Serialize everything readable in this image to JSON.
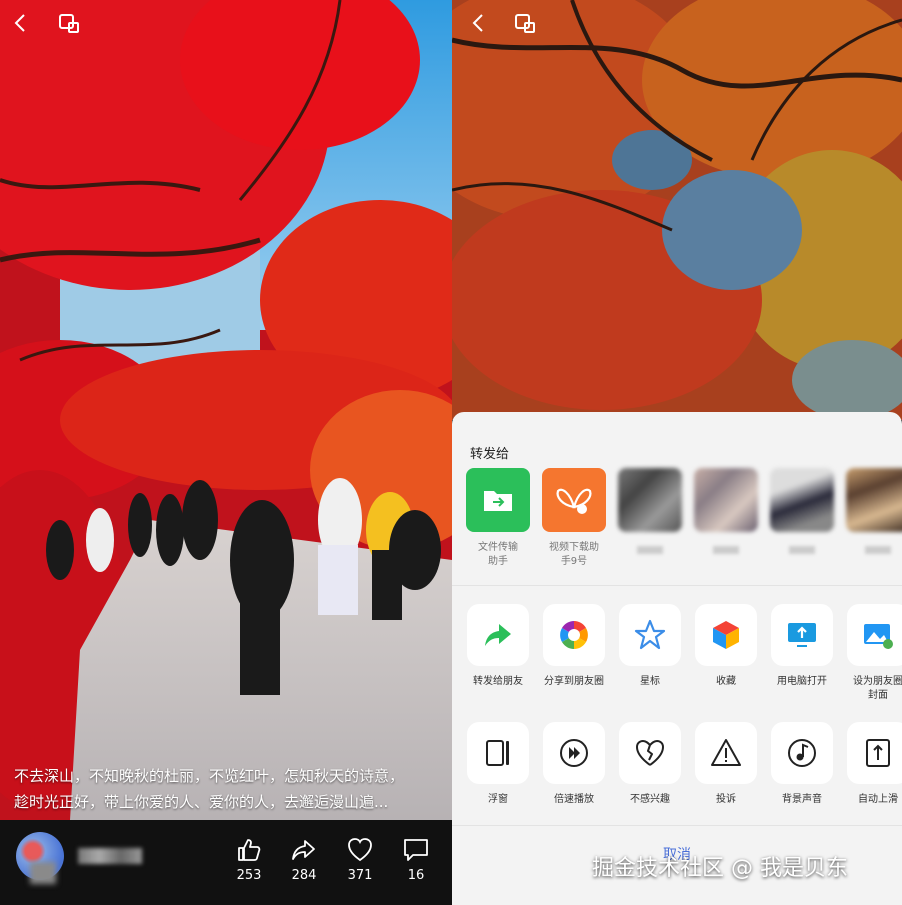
{
  "left": {
    "caption_line1": "不去深山，不知晚秋的杜丽，不览红叶，怎知秋天的诗意，",
    "caption_line2": "趁时光正好，带上你爱的人、爱你的人，去邂逅漫山遍...",
    "actions": [
      {
        "icon": "thumbs-up-icon",
        "count": "253"
      },
      {
        "icon": "share-arrow-icon",
        "count": "284"
      },
      {
        "icon": "heart-icon",
        "count": "371"
      },
      {
        "icon": "comment-icon",
        "count": "16"
      }
    ]
  },
  "sheet": {
    "title": "转发给",
    "contacts": [
      {
        "label": "文件传输\n助手",
        "color": "#2bbf5a"
      },
      {
        "label": "视频下载助\n手9号",
        "color": "#f5762f"
      }
    ],
    "row1": [
      {
        "label": "转发给朋友",
        "icon": "forward-arrow-icon"
      },
      {
        "label": "分享到朋友圈",
        "icon": "moments-aperture-icon"
      },
      {
        "label": "星标",
        "icon": "star-icon"
      },
      {
        "label": "收藏",
        "icon": "favorites-cube-icon"
      },
      {
        "label": "用电脑打开",
        "icon": "computer-icon"
      },
      {
        "label": "设为朋友圈\n封面",
        "icon": "cover-image-icon"
      }
    ],
    "row2": [
      {
        "label": "浮窗",
        "icon": "float-window-icon"
      },
      {
        "label": "倍速播放",
        "icon": "playback-speed-icon"
      },
      {
        "label": "不感兴趣",
        "icon": "broken-heart-icon"
      },
      {
        "label": "投诉",
        "icon": "warning-icon"
      },
      {
        "label": "背景声音",
        "icon": "music-note-icon"
      },
      {
        "label": "自动上滑",
        "icon": "auto-scroll-icon"
      }
    ],
    "cancel": "取消"
  },
  "watermark": "掘金技术社区 @ 我是贝东"
}
